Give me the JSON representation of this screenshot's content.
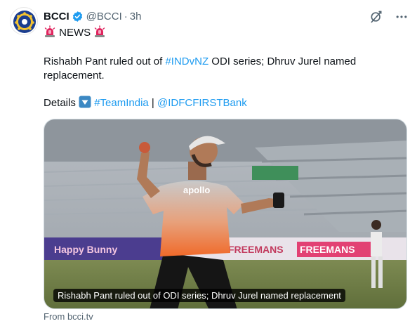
{
  "post": {
    "author_name": "BCCI",
    "handle": "@BCCI",
    "separator": "·",
    "time": "3h",
    "headline": "NEWS",
    "text_before_tag": "Rishabh Pant ruled out of ",
    "hashtag_series": "#INDvNZ",
    "text_after_tag": " ODI series; Dhruv Jurel named",
    "text_line2": "replacement.",
    "details_label": "Details ",
    "hashtag_team": "#TeamIndia",
    "pipe": " | ",
    "mention": "@IDFCFIRSTBank"
  },
  "card": {
    "caption": "Rishabh Pant ruled out of ODI series; Dhruv Jurel named replacement",
    "source": "From bcci.tv",
    "jersey_brand": "apollo"
  },
  "icons": {
    "avatar": "bcci-logo-icon",
    "verified": "verified-badge-icon",
    "grok": "grok-icon",
    "more": "more-options-icon",
    "siren": "police-light-icon",
    "down_arrow": "down-arrow-button-icon"
  },
  "colors": {
    "link": "#1d9bf0",
    "text": "#0f1419",
    "secondary": "#536471"
  }
}
